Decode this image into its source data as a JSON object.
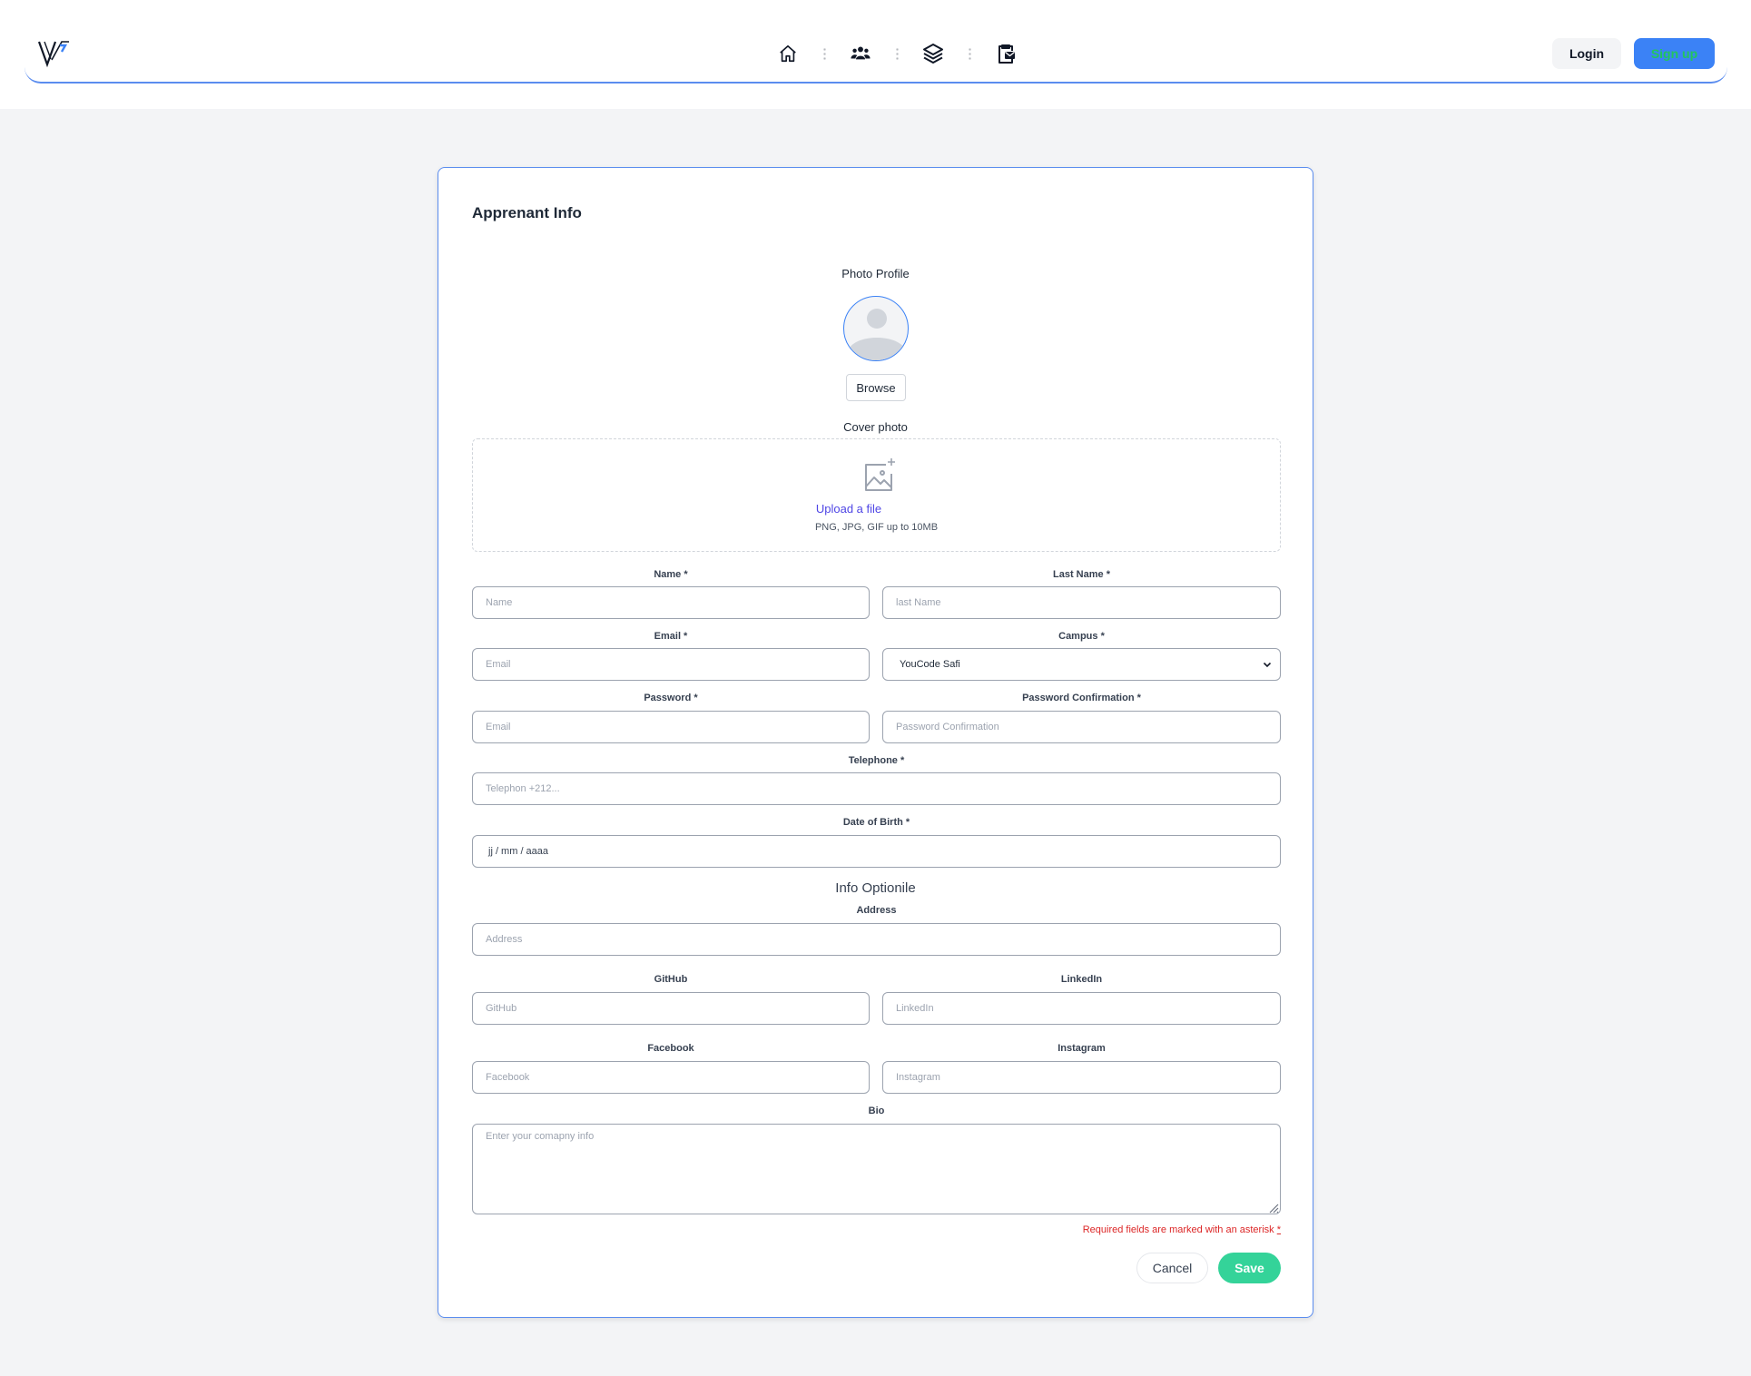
{
  "header": {
    "logo_icon": "brand-logo-icon",
    "nav_icons": [
      "home-icon",
      "users-icon",
      "layers-icon",
      "clipboard-icon"
    ],
    "login_label": "Login",
    "signup_label": "Sign up"
  },
  "form": {
    "title": "Apprenant Info",
    "photo_profile_label": "Photo Profile",
    "browse_label": "Browse",
    "cover_photo_label": "Cover photo",
    "upload_link": "Upload a file",
    "upload_hint": "PNG, JPG, GIF up to 10MB",
    "fields": {
      "name": {
        "label": "Name *",
        "placeholder": "Name"
      },
      "last_name": {
        "label": "Last Name *",
        "placeholder": "last Name"
      },
      "email": {
        "label": "Email *",
        "placeholder": "Email"
      },
      "campus": {
        "label": "Campus *",
        "value": "YouCode Safi"
      },
      "password": {
        "label": "Password *",
        "placeholder": "Email"
      },
      "password_confirmation": {
        "label": "Password Confirmation *",
        "placeholder": "Password Confirmation"
      },
      "telephone": {
        "label": "Telephone *",
        "placeholder": "Telephon +212..."
      },
      "date_of_birth": {
        "label": "Date of Birth *",
        "value": "jj / mm / aaaa"
      }
    },
    "optional_section_title": "Info Optionile",
    "optional_fields": {
      "address": {
        "label": "Address",
        "placeholder": "Address"
      },
      "github": {
        "label": "GitHub",
        "placeholder": "GitHub"
      },
      "linkedin": {
        "label": "LinkedIn",
        "placeholder": "LinkedIn"
      },
      "facebook": {
        "label": "Facebook",
        "placeholder": "Facebook"
      },
      "instagram": {
        "label": "Instagram",
        "placeholder": "Instagram"
      },
      "bio": {
        "label": "Bio",
        "placeholder": "Enter your comapny info"
      }
    },
    "required_note": "Required fields are marked with an asterisk",
    "required_asterisk": "*",
    "cancel_label": "Cancel",
    "save_label": "Save"
  },
  "colors": {
    "page_bg": "#f3f4f6",
    "accent_blue": "#3b82f6",
    "signup_text": "#22c55e",
    "save_green": "#34d399",
    "upload_link": "#4f46e5",
    "required_red": "#dc2626"
  }
}
